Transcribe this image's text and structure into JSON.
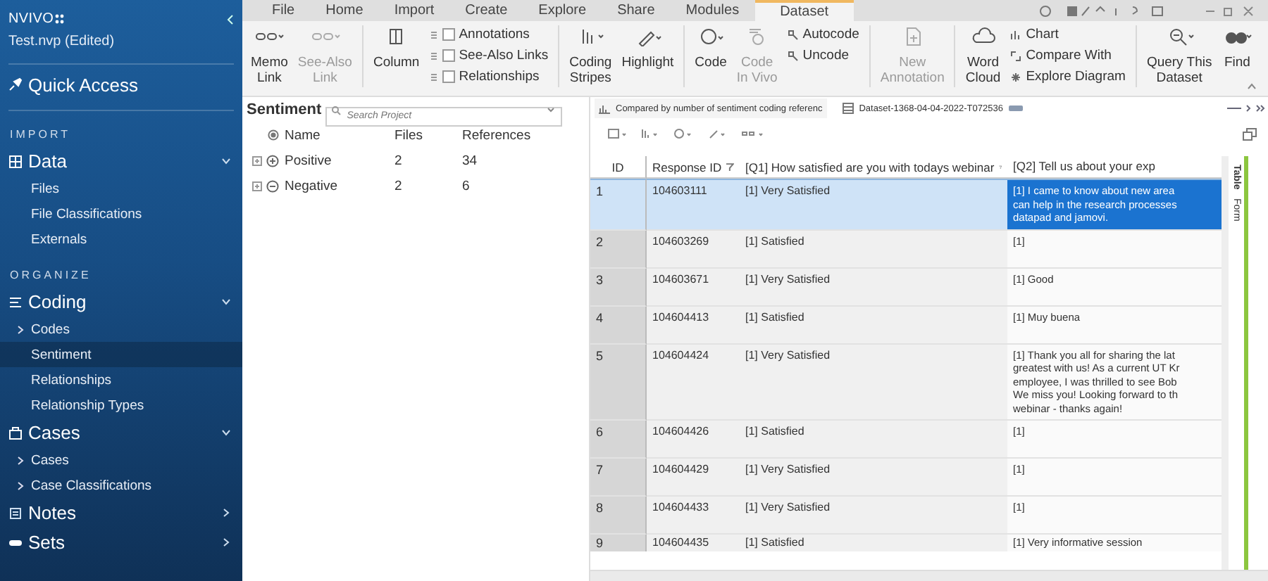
{
  "sidebar": {
    "logo": "NVIVO",
    "project": "Test.nvp (Edited)",
    "quick_access": "Quick Access",
    "items": [
      {
        "kind": "heading",
        "label": "IMPORT"
      },
      {
        "kind": "group",
        "label": "Data",
        "expanded": true
      },
      {
        "kind": "item",
        "label": "Files",
        "expandable": false,
        "selected": false
      },
      {
        "kind": "item",
        "label": "File Classifications",
        "expandable": false,
        "selected": false
      },
      {
        "kind": "item",
        "label": "Externals",
        "expandable": false,
        "selected": false
      },
      {
        "kind": "heading",
        "label": "ORGANIZE"
      },
      {
        "kind": "group",
        "label": "Coding",
        "expanded": true
      },
      {
        "kind": "item",
        "label": "Codes",
        "expandable": true,
        "selected": false
      },
      {
        "kind": "item",
        "label": "Sentiment",
        "expandable": false,
        "selected": true
      },
      {
        "kind": "item",
        "label": "Relationships",
        "expandable": false,
        "selected": false
      },
      {
        "kind": "item",
        "label": "Relationship Types",
        "expandable": false,
        "selected": false
      },
      {
        "kind": "group",
        "label": "Cases",
        "expanded": true
      },
      {
        "kind": "item",
        "label": "Cases",
        "expandable": true,
        "selected": false
      },
      {
        "kind": "item",
        "label": "Case Classifications",
        "expandable": true,
        "selected": false
      },
      {
        "kind": "group",
        "label": "Notes",
        "expanded": false
      },
      {
        "kind": "group",
        "label": "Sets",
        "expanded": false
      }
    ]
  },
  "tabs": [
    {
      "label": "File",
      "selected": false
    },
    {
      "label": "Home",
      "selected": false
    },
    {
      "label": "Import",
      "selected": false
    },
    {
      "label": "Create",
      "selected": false
    },
    {
      "label": "Explore",
      "selected": false
    },
    {
      "label": "Share",
      "selected": false
    },
    {
      "label": "Modules",
      "selected": false
    },
    {
      "label": "Dataset",
      "selected": true
    }
  ],
  "ribbon": [
    {
      "kind": "large",
      "label": [
        "Memo",
        "Link"
      ],
      "disabled": false
    },
    {
      "kind": "large",
      "label": [
        "See-Also",
        "Link"
      ],
      "disabled": true
    },
    {
      "kind": "sep"
    },
    {
      "kind": "large",
      "label": [
        "Column"
      ],
      "disabled": false
    },
    {
      "kind": "checks",
      "items": [
        {
          "label": "Annotations",
          "checked": false
        },
        {
          "label": "See-Also Links",
          "checked": false
        },
        {
          "label": "Relationships",
          "checked": false
        }
      ]
    },
    {
      "kind": "sep"
    },
    {
      "kind": "large",
      "label": [
        "Coding",
        "Stripes"
      ],
      "disabled": false
    },
    {
      "kind": "large",
      "label": [
        "Highlight"
      ],
      "disabled": false
    },
    {
      "kind": "sep"
    },
    {
      "kind": "large",
      "label": [
        "Code"
      ],
      "disabled": false
    },
    {
      "kind": "large",
      "label": [
        "Code",
        "In Vivo"
      ],
      "disabled": true
    },
    {
      "kind": "smalls",
      "items": [
        {
          "label": "Autocode"
        },
        {
          "label": "Uncode"
        }
      ]
    },
    {
      "kind": "sep"
    },
    {
      "kind": "large",
      "label": [
        "New",
        "Annotation"
      ],
      "disabled": true
    },
    {
      "kind": "sep"
    },
    {
      "kind": "large",
      "label": [
        "Word",
        "Cloud"
      ],
      "disabled": false
    },
    {
      "kind": "smalls",
      "items": [
        {
          "label": "Chart"
        },
        {
          "label": "Compare With"
        },
        {
          "label": "Explore Diagram"
        }
      ]
    },
    {
      "kind": "sep"
    },
    {
      "kind": "large",
      "label": [
        "Query This",
        "Dataset"
      ],
      "disabled": false
    },
    {
      "kind": "large",
      "label": [
        "Find"
      ],
      "disabled": false
    }
  ],
  "sentiment": {
    "title": "Sentiment",
    "search": {
      "placeholder": "Search Project"
    },
    "columns": [
      "Name",
      "Files",
      "References"
    ],
    "rows": [
      {
        "kind": "positive",
        "name": "Positive",
        "files": "2",
        "references": "34"
      },
      {
        "kind": "negative",
        "name": "Negative",
        "files": "2",
        "references": "6"
      }
    ]
  },
  "documents": [
    {
      "label": "Compared by number of sentiment coding referenc",
      "selected": false
    },
    {
      "label": "Dataset-1368-04-04-2022-T072536",
      "selected": true
    }
  ],
  "table": {
    "columns": [
      "ID",
      "Response ID",
      "[Q1] How satisfied are you with todays webinar",
      "[Q2] Tell us about your exp"
    ],
    "rows": [
      {
        "id": "1",
        "response_id": "104603111",
        "q1": "[1] Very Satisfied",
        "q2": [
          "[1] I came to know about new area",
          "can help in the research processes",
          "datapad and jamovi."
        ],
        "selected": true
      },
      {
        "id": "2",
        "response_id": "104603269",
        "q1": "[1] Satisfied",
        "q2": [
          "[1]"
        ],
        "selected": false
      },
      {
        "id": "3",
        "response_id": "104603671",
        "q1": "[1] Very Satisfied",
        "q2": [
          "[1] Good"
        ],
        "selected": false
      },
      {
        "id": "4",
        "response_id": "104604413",
        "q1": "[1] Satisfied",
        "q2": [
          "[1] Muy buena"
        ],
        "selected": false
      },
      {
        "id": "5",
        "response_id": "104604424",
        "q1": "[1] Very Satisfied",
        "q2": [
          "[1] Thank you all for sharing the lat",
          "greatest with us! As a current UT Kr",
          "employee, I was thrilled to see Bob",
          "We miss you! Looking forward to th",
          "webinar - thanks again!"
        ],
        "selected": false
      },
      {
        "id": "6",
        "response_id": "104604426",
        "q1": "[1] Satisfied",
        "q2": [
          "[1]"
        ],
        "selected": false
      },
      {
        "id": "7",
        "response_id": "104604429",
        "q1": "[1] Very Satisfied",
        "q2": [
          "[1]"
        ],
        "selected": false
      },
      {
        "id": "8",
        "response_id": "104604433",
        "q1": "[1] Very Satisfied",
        "q2": [
          "[1]"
        ],
        "selected": false
      },
      {
        "id": "9",
        "response_id": "104604435",
        "q1": "[1] Satisfied",
        "q2": [
          "[1] Very informative session"
        ],
        "selected": false
      }
    ]
  },
  "view_tabs": [
    "Table",
    "Form"
  ]
}
